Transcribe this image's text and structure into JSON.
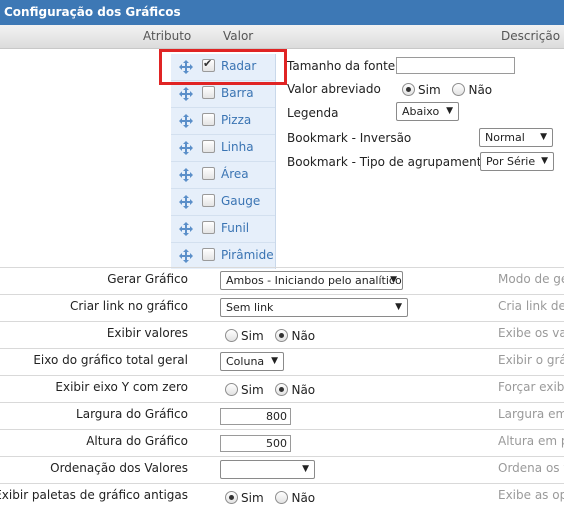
{
  "title": "Configuração dos Gráficos",
  "columns": {
    "atributo": "Atributo",
    "valor": "Valor",
    "descricao": "Descrição"
  },
  "chart_types": [
    {
      "label": "Radar",
      "checked": true
    },
    {
      "label": "Barra",
      "checked": false
    },
    {
      "label": "Pizza",
      "checked": false
    },
    {
      "label": "Linha",
      "checked": false
    },
    {
      "label": "Área",
      "checked": false
    },
    {
      "label": "Gauge",
      "checked": false
    },
    {
      "label": "Funil",
      "checked": false
    },
    {
      "label": "Pirâmide",
      "checked": false
    }
  ],
  "options": {
    "font_size_label": "Tamanho da fonte",
    "font_size_value": "",
    "abbrev_label": "Valor abreviado",
    "abbrev_yes": "Sim",
    "abbrev_no": "Não",
    "legend_label": "Legenda",
    "legend_value": "Abaixo",
    "bm_inv_label": "Bookmark - Inversão",
    "bm_inv_value": "Normal",
    "bm_grp_label": "Bookmark - Tipo de agrupamento",
    "bm_grp_value": "Por Série"
  },
  "attributes": [
    {
      "label": "Gerar Gráfico",
      "type": "select",
      "value": "Ambos - Iniciando pelo analítico",
      "desc": "Modo de ge"
    },
    {
      "label": "Criar link no gráfico",
      "type": "select",
      "value": "Sem link",
      "desc": "Cria link der"
    },
    {
      "label": "Exibir valores",
      "type": "radio",
      "yes": "Sim",
      "no": "Não",
      "selected": "no",
      "desc": "Exibe os val"
    },
    {
      "label": "Eixo do gráfico total geral",
      "type": "select",
      "value": "Coluna",
      "desc": "Exibir o gráf"
    },
    {
      "label": "Exibir eixo Y com zero",
      "type": "radio",
      "yes": "Sim",
      "no": "Não",
      "selected": "no",
      "desc": "Forçar exibi"
    },
    {
      "label": "Largura do Gráfico",
      "type": "number",
      "value": "800",
      "desc": "Largura em"
    },
    {
      "label": "Altura do Gráfico",
      "type": "number",
      "value": "500",
      "desc": "Altura em pi"
    },
    {
      "label": "Ordenação dos Valores",
      "type": "select",
      "value": "",
      "desc": "Ordena os v"
    },
    {
      "label": "Exibir paletas de gráfico antigas",
      "type": "radio",
      "yes": "Sim",
      "no": "Não",
      "selected": "yes",
      "desc": "Exibe as ope"
    }
  ]
}
